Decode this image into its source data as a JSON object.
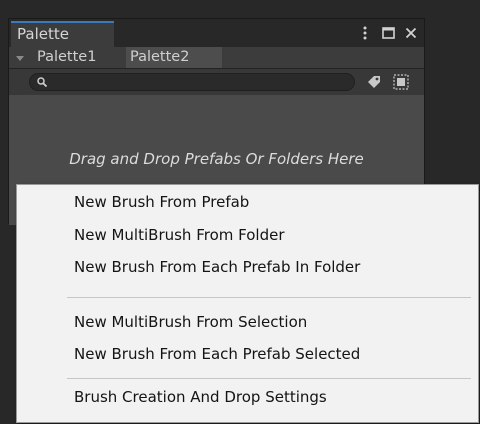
{
  "window": {
    "tab_title": "Palette",
    "icons": [
      "kebab-menu-icon",
      "maximize-icon",
      "close-icon"
    ]
  },
  "palette_tabs": {
    "items": [
      {
        "label": "Palette1"
      },
      {
        "label": "Palette2"
      }
    ]
  },
  "search": {
    "value": "",
    "placeholder": ""
  },
  "dropzone": {
    "text": "Drag and Drop Prefabs Or Folders Here"
  },
  "context_menu": {
    "groups": [
      [
        {
          "label": "New Brush From Prefab"
        },
        {
          "label": "New MultiBrush From Folder"
        },
        {
          "label": "New Brush From Each Prefab In Folder"
        }
      ],
      [
        {
          "label": "New MultiBrush From Selection"
        },
        {
          "label": "New Brush From Each Prefab Selected"
        }
      ],
      [
        {
          "label": "Brush Creation And Drop Settings"
        }
      ]
    ]
  },
  "colors": {
    "accent_tab_line": "#3a79bb",
    "panel_bg": "#383838",
    "dropzone_bg": "#4a4a4a",
    "menu_bg": "#f2f2f2"
  }
}
